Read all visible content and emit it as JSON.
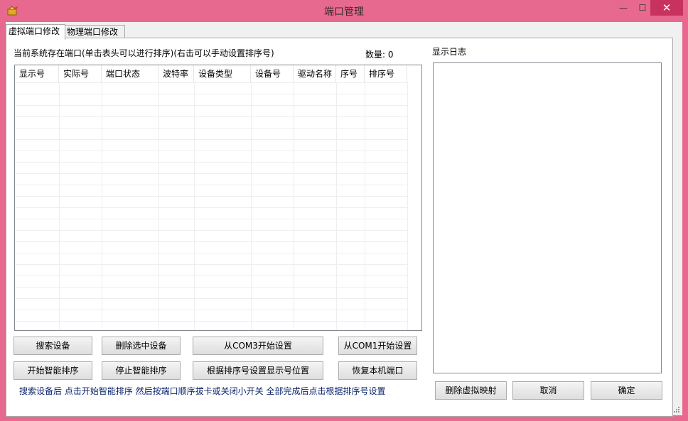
{
  "window": {
    "title": "端口管理",
    "close_glyph": "✕",
    "min_glyph": "—",
    "max_glyph": "☐"
  },
  "tabs": [
    {
      "label": "虚拟端口修改",
      "active": true
    },
    {
      "label": "物理端口修改",
      "active": false
    }
  ],
  "ports": {
    "caption": "当前系统存在端口(单击表头可以进行排序)(右击可以手动设置排序号)",
    "count_label": "数量: 0",
    "columns": [
      "显示号",
      "实际号",
      "端口状态",
      "波特率",
      "设备类型",
      "设备号",
      "驱动名称",
      "序号",
      "排序号"
    ],
    "rows": []
  },
  "buttons": {
    "search": "搜索设备",
    "delete_selected": "删除选中设备",
    "from_com3": "从COM3开始设置",
    "from_com1": "从COM1开始设置",
    "start_sort": "开始智能排序",
    "stop_sort": "停止智能排序",
    "set_by_sort": "根据排序号设置显示号位置",
    "restore_local": "恢复本机端口"
  },
  "hint": "搜索设备后 点击开始智能排序 然后按端口顺序拔卡或关闭小开关 全部完成后点击根据排序号设置",
  "log": {
    "label": "显示日志",
    "content": ""
  },
  "footer_buttons": {
    "delete_virtual": "删除虚拟映射",
    "cancel": "取消",
    "ok": "确定"
  }
}
